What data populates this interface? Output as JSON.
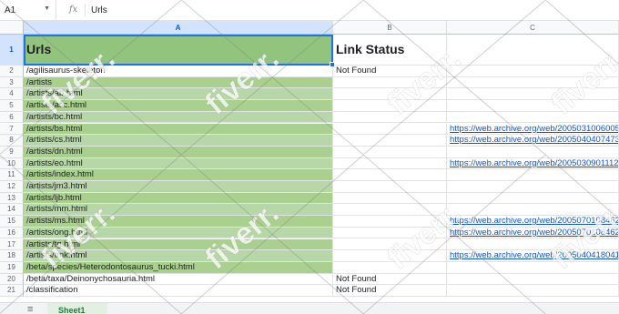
{
  "formula_bar": {
    "cell_ref": "A1",
    "fx": "fx",
    "content": "Urls"
  },
  "columns": [
    "A",
    "B",
    "C"
  ],
  "header_row": {
    "a": "Urls",
    "b": "Link Status"
  },
  "rows": [
    {
      "n": "2",
      "a": "/agilisaurus-skeleton",
      "b": "Not Found",
      "c": "",
      "fill": "none"
    },
    {
      "n": "3",
      "a": "/artists",
      "b": "",
      "c": "",
      "fill": "green"
    },
    {
      "n": "4",
      "a": "/artists/ab.html",
      "b": "",
      "c": "",
      "fill": "green"
    },
    {
      "n": "5",
      "a": "/artists/asc.html",
      "b": "",
      "c": "",
      "fill": "green"
    },
    {
      "n": "6",
      "a": "/artists/bc.html",
      "b": "",
      "c": "",
      "fill": "green"
    },
    {
      "n": "7",
      "a": "/artists/bs.html",
      "b": "",
      "c": "https://web.archive.org/web/2005031006005",
      "fill": "green"
    },
    {
      "n": "8",
      "a": "/artists/cs.html",
      "b": "",
      "c": "https://web.archive.org/web/2005040407473",
      "fill": "green"
    },
    {
      "n": "9",
      "a": "/artists/dn.html",
      "b": "",
      "c": "",
      "fill": "green"
    },
    {
      "n": "10",
      "a": "/artists/eo.html",
      "b": "",
      "c": "https://web.archive.org/web/2005030901112",
      "fill": "green"
    },
    {
      "n": "11",
      "a": "/artists/index.html",
      "b": "",
      "c": "",
      "fill": "green"
    },
    {
      "n": "12",
      "a": "/artists/jm3.html",
      "b": "",
      "c": "",
      "fill": "green"
    },
    {
      "n": "13",
      "a": "/artists/ljb.html",
      "b": "",
      "c": "",
      "fill": "green"
    },
    {
      "n": "14",
      "a": "/artists/mm.html",
      "b": "",
      "c": "",
      "fill": "green"
    },
    {
      "n": "15",
      "a": "/artists/ms.html",
      "b": "",
      "c": "https://web.archive.org/web/2005070108462",
      "fill": "green"
    },
    {
      "n": "16",
      "a": "/artists/ong.html",
      "b": "",
      "c": "https://web.archive.org/web/2005070108462",
      "fill": "green"
    },
    {
      "n": "17",
      "a": "/artists/tg.html",
      "b": "",
      "c": "",
      "fill": "green"
    },
    {
      "n": "18",
      "a": "/artists/tmk.html",
      "b": "",
      "c": "https://web.archive.org/web/2005040418041",
      "fill": "green"
    },
    {
      "n": "19",
      "a": "/beta/species/Heterodontosaurus_tucki.html",
      "b": "",
      "c": "",
      "fill": "green"
    },
    {
      "n": "20",
      "a": "/beta/taxa/Deinonychosauria.html",
      "b": "Not Found",
      "c": "",
      "fill": "none"
    },
    {
      "n": "21",
      "a": "/classification",
      "b": "Not Found",
      "c": "",
      "fill": "none"
    }
  ],
  "sheet_tab": {
    "label": "Sheet1"
  },
  "watermark": "fiverr."
}
